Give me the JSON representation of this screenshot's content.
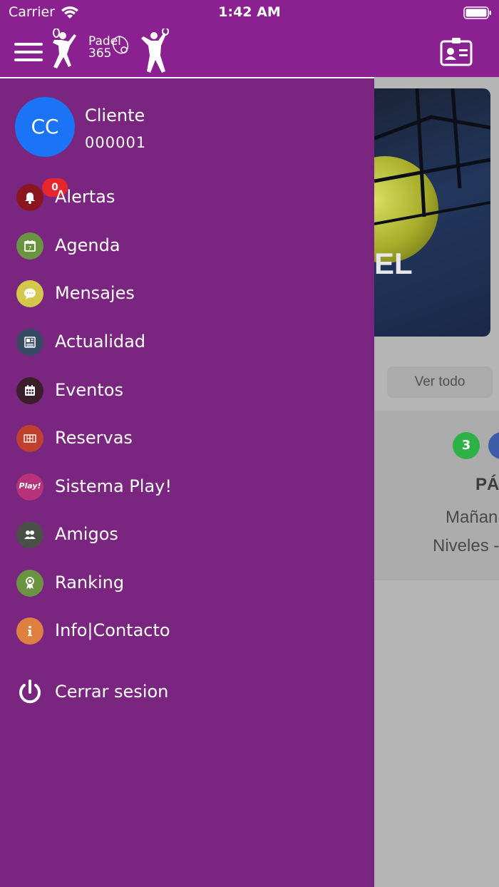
{
  "status_bar": {
    "carrier": "Carrier",
    "time": "1:42 AM"
  },
  "header": {
    "logo_text_line1": "Padel",
    "logo_text_line2": "365"
  },
  "user": {
    "initials": "CC",
    "name": "Cliente",
    "id": "000001"
  },
  "menu": {
    "alerts": {
      "label": "Alertas",
      "badge": "0"
    },
    "agenda": {
      "label": "Agenda"
    },
    "messages": {
      "label": "Mensajes"
    },
    "news": {
      "label": "Actualidad"
    },
    "events": {
      "label": "Eventos"
    },
    "bookings": {
      "label": "Reservas"
    },
    "play": {
      "label": "Sistema Play!",
      "icon_text": "Play!"
    },
    "friends": {
      "label": "Amigos"
    },
    "ranking": {
      "label": "Ranking"
    },
    "info": {
      "label": "Info|Contacto"
    },
    "logout": {
      "label": "Cerrar sesion"
    }
  },
  "background": {
    "banner_text": "EL",
    "see_all": "Ver todo",
    "card_number": "3",
    "card_title": "PÁ",
    "card_line1": "Mañan",
    "card_line2": "Niveles -"
  },
  "colors": {
    "header": "#8b2191",
    "drawer": "#7a257f",
    "avatar": "#1a74f5",
    "alert_badge": "#e8242c",
    "alerts_icon": "#8a1620",
    "agenda_icon": "#6a9442",
    "messages_icon": "#d4c84a",
    "news_icon": "#364b63",
    "events_icon": "#3a1e2a",
    "bookings_icon": "#c0402e",
    "play_icon": "#b8327a",
    "friends_icon": "#4a5048",
    "ranking_icon": "#6a9442",
    "info_icon": "#dd8040"
  }
}
